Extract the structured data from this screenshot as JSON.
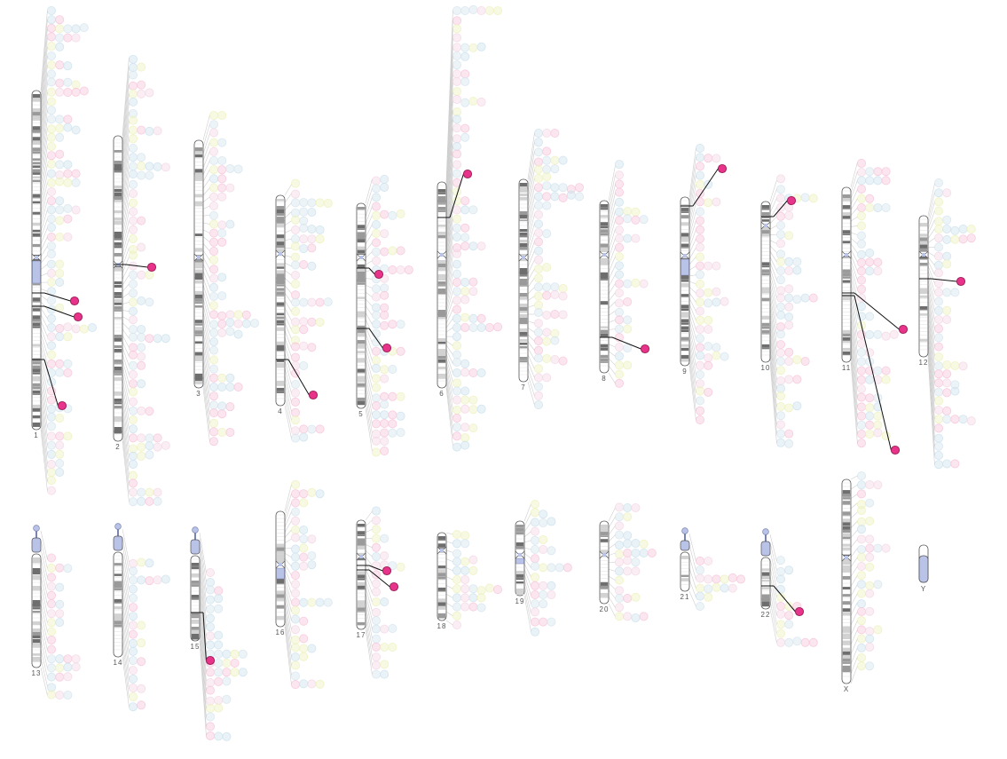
{
  "colors": {
    "hit": "#e8338a",
    "hit_stroke": "#9a1c57",
    "centromere": "#b9c3e8",
    "band_dark": "#6e6e6e",
    "band_light": "#d2d2d2",
    "link_line": "#cfcfcf",
    "highlight_line": "#111111",
    "ghost_palette": [
      "#f7c8dc",
      "#cfe3ee",
      "#eef2c2",
      "#d8e6f0",
      "#f4d9e6"
    ]
  },
  "chromosomes": [
    {
      "id": "1",
      "label": "1"
    },
    {
      "id": "2",
      "label": "2"
    },
    {
      "id": "3",
      "label": "3"
    },
    {
      "id": "4",
      "label": "4"
    },
    {
      "id": "5",
      "label": "5"
    },
    {
      "id": "6",
      "label": "6"
    },
    {
      "id": "7",
      "label": "7"
    },
    {
      "id": "8",
      "label": "8"
    },
    {
      "id": "9",
      "label": "9"
    },
    {
      "id": "10",
      "label": "10"
    },
    {
      "id": "11",
      "label": "11"
    },
    {
      "id": "12",
      "label": "12"
    },
    {
      "id": "13",
      "label": "13"
    },
    {
      "id": "14",
      "label": "14"
    },
    {
      "id": "15",
      "label": "15"
    },
    {
      "id": "16",
      "label": "16"
    },
    {
      "id": "17",
      "label": "17"
    },
    {
      "id": "18",
      "label": "18"
    },
    {
      "id": "19",
      "label": "19"
    },
    {
      "id": "20",
      "label": "20"
    },
    {
      "id": "21",
      "label": "21"
    },
    {
      "id": "22",
      "label": "22"
    },
    {
      "id": "X",
      "label": "X"
    },
    {
      "id": "Y",
      "label": "Y"
    }
  ],
  "highlighted_hits": [
    {
      "chromosome": "1",
      "count": 3
    },
    {
      "chromosome": "2",
      "count": 1
    },
    {
      "chromosome": "4",
      "count": 1
    },
    {
      "chromosome": "5",
      "count": 2
    },
    {
      "chromosome": "6",
      "count": 1
    },
    {
      "chromosome": "8",
      "count": 1
    },
    {
      "chromosome": "9",
      "count": 1
    },
    {
      "chromosome": "10",
      "count": 1
    },
    {
      "chromosome": "11",
      "count": 2
    },
    {
      "chromosome": "12",
      "count": 1
    },
    {
      "chromosome": "15",
      "count": 1
    },
    {
      "chromosome": "17",
      "count": 2
    },
    {
      "chromosome": "22",
      "count": 1
    }
  ]
}
